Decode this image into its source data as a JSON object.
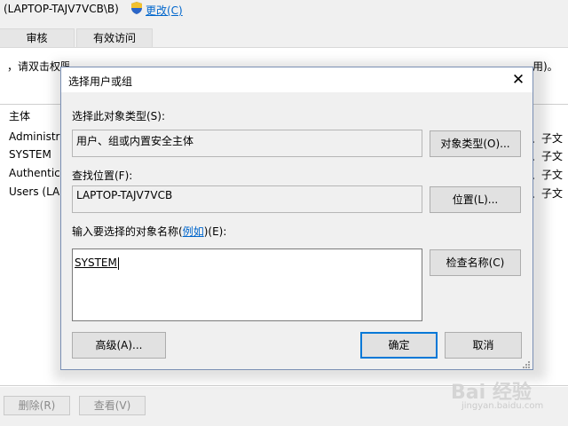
{
  "background": {
    "title": "(LAPTOP-TAJV7VCB\\B)",
    "change_link": "更改(C)",
    "tabs": [
      "审核",
      "有效访问"
    ],
    "instruction": "，请双击权限项目",
    "instruction_tail": "用)。",
    "principal_header": "主体",
    "rows": [
      {
        "name": "Administra",
        "tail": "、子文"
      },
      {
        "name": "SYSTEM",
        "tail": "、子文"
      },
      {
        "name": "Authentica",
        "tail": "、子文"
      },
      {
        "name": "Users (LAP",
        "tail": "、子文"
      }
    ],
    "delete_button": "删除(R)",
    "view_button": "查看(V)"
  },
  "dialog": {
    "title": "选择用户或组",
    "close_glyph": "✕",
    "object_type_label": "选择此对象类型(S):",
    "object_type_value": "用户、组或内置安全主体",
    "object_type_button": "对象类型(O)...",
    "location_label": "查找位置(F):",
    "location_value": "LAPTOP-TAJV7VCB",
    "location_button": "位置(L)...",
    "object_name_label_prefix": "输入要选择的对象名称(",
    "example_link": "例如",
    "object_name_label_suffix": ")(E):",
    "object_name_value": "SYSTEM",
    "check_names_button": "检查名称(C)",
    "advanced_button": "高级(A)...",
    "ok_button": "确定",
    "cancel_button": "取消"
  },
  "watermark": {
    "text": "Bai 经验",
    "sub": "jingyan.baidu.com"
  },
  "colors": {
    "accent": "#0078d7",
    "link": "#0066cc"
  }
}
